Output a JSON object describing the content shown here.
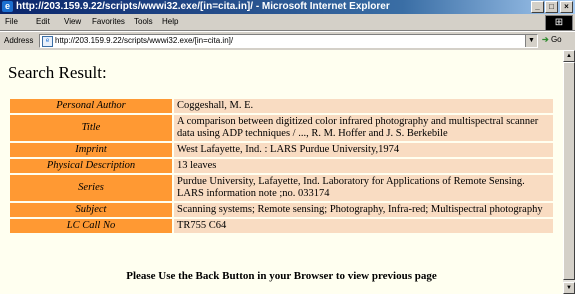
{
  "window": {
    "title": "http://203.159.9.22/scripts/wwwi32.exe/[in=cita.in]/ - Microsoft Internet Explorer",
    "app_icon": "ie-icon",
    "controls": [
      "minimize-icon",
      "maximize-icon",
      "close-icon"
    ]
  },
  "menu": {
    "items": [
      {
        "label": "File"
      },
      {
        "label": "Edit"
      },
      {
        "label": "View"
      },
      {
        "label": "Favorites"
      },
      {
        "label": "Tools"
      },
      {
        "label": "Help"
      }
    ]
  },
  "address_bar": {
    "label": "Address",
    "value": "http://203.159.9.22/scripts/wwwi32.exe/[in=cita.in]/",
    "go_label": "Go"
  },
  "page": {
    "heading": "Search Result:",
    "rows": [
      {
        "label": "Personal Author",
        "value": "Coggeshall, M. E."
      },
      {
        "label": "Title",
        "value": "A comparison between digitized color infrared photography and multispectral scanner data using ADP techniques / ..., R. M. Hoffer and J. S. Berkebile"
      },
      {
        "label": "Imprint",
        "value": "West Lafayette, Ind. : LARS Purdue University,1974"
      },
      {
        "label": "Physical Description",
        "value": "13 leaves"
      },
      {
        "label": "Series",
        "value": "Purdue University, Lafayette, Ind. Laboratory for Applications of Remote Sensing. LARS information note ;no. 033174"
      },
      {
        "label": "Subject",
        "value": "Scanning systems; Remote sensing; Photography, Infra-red; Multispectral photography"
      },
      {
        "label": "LC Call No",
        "value": "TR755 C64"
      }
    ],
    "footer": "Please Use the Back Button in your Browser to view previous page"
  },
  "colors": {
    "label_bg": "#ff9933",
    "value_bg": "#f9dcc2",
    "page_bg": "#fffff0",
    "titlebar": "#0a246a"
  }
}
